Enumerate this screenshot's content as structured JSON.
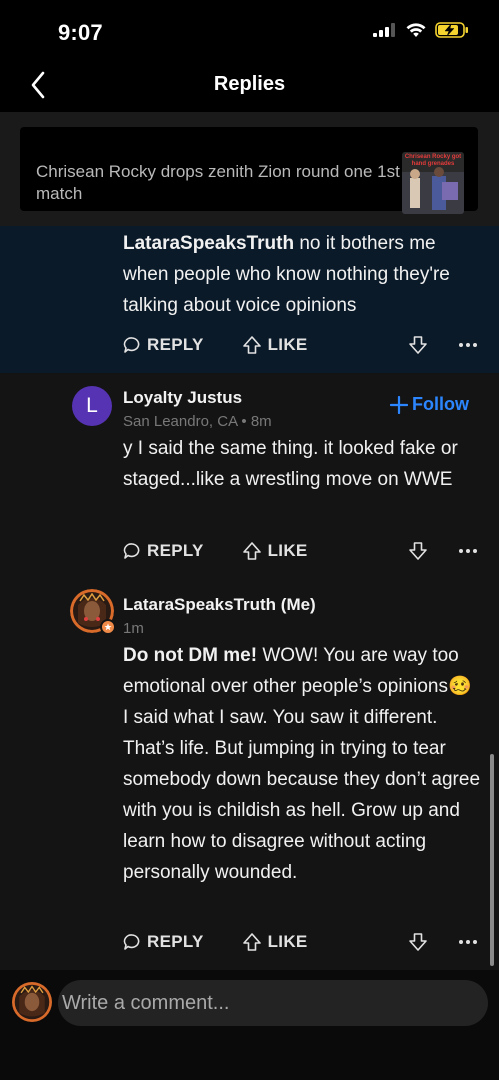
{
  "status_bar": {
    "time": "9:07"
  },
  "nav": {
    "title": "Replies"
  },
  "article": {
    "title": "Chrisean Rocky drops zenith Zion round one 1st match",
    "thumbnail_caption": "Chrisean Rocky got hand grenades"
  },
  "comments": [
    {
      "mention": "LataraSpeaksTruth",
      "text": " no it bothers me when people who know nothing they're talking about voice opinions",
      "reply_label": "REPLY",
      "like_label": "LIKE"
    },
    {
      "author": "Loyalty Justus",
      "avatar_letter": "L",
      "meta": "San Leandro, CA • 8m",
      "follow_label": "Follow",
      "text": "y I said the same thing. it looked fake or staged...like a wrestling move on WWE",
      "reply_label": "REPLY",
      "like_label": "LIKE"
    },
    {
      "author": "LataraSpeaksTruth (Me)",
      "meta": "1m",
      "bold_prefix": "Do not DM me!",
      "text_part1": " WOW! You are way too emotional over other people’s opinions",
      "emoji": "🥴",
      "text_part2": " I said what I saw. You saw it different. That’s life. But jumping in trying to tear somebody down because they don’t agree with you is childish as hell. Grow up and learn how to disagree without acting personally wounded.",
      "reply_label": "REPLY",
      "like_label": "LIKE"
    }
  ],
  "composer": {
    "placeholder": "Write a comment..."
  },
  "colors": {
    "background": "#000000",
    "highlight": "#0b1a29",
    "comment_bg": "#141414",
    "accent_blue": "#2c86ff",
    "avatar_purple": "#5533b3",
    "badge_orange": "#f08a48"
  }
}
